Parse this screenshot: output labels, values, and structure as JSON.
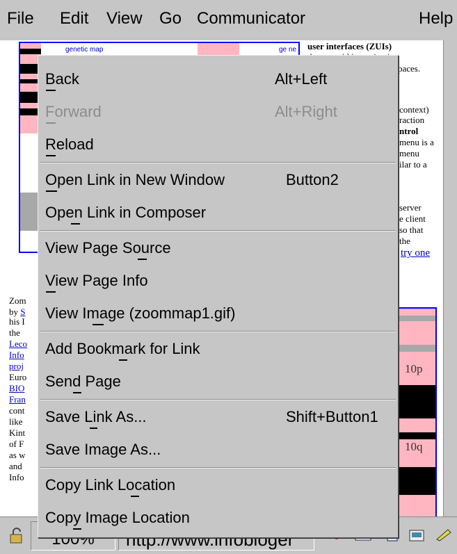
{
  "menubar": {
    "items": [
      "File",
      "Edit",
      "View",
      "Go",
      "Communicator"
    ],
    "help": "Help"
  },
  "page": {
    "map_label_1": "genetic map",
    "map_label_2": "ge ne",
    "map_band_1": "10p",
    "map_band_2": "10q",
    "right_text": [
      "user interfaces (ZUIs)",
      "that can aid in navigating",
      "paces.",
      "context)",
      "raction",
      "ntrol",
      "menu is a",
      "menu",
      "ilar to a",
      "server",
      "e client",
      "so that",
      "the"
    ],
    "right_link": "try one",
    "left_text": [
      "Zom",
      "by ",
      "his I",
      "the ",
      "Leco",
      "Info",
      "proj",
      "Euro",
      "BIO",
      "Fran",
      "cont",
      "like ",
      "Kint",
      "of F",
      "as w",
      "and ",
      "Info"
    ],
    "left_link_s": "S"
  },
  "statusbar": {
    "zoom": "100%",
    "url": "http://www.infobloger"
  },
  "menu": {
    "items": [
      {
        "label": "Back",
        "accel": "Alt+Left",
        "enabled": true
      },
      {
        "label": "Forward",
        "accel": "Alt+Right",
        "enabled": false
      },
      {
        "label": "Reload",
        "accel": "",
        "enabled": true
      },
      {
        "label": "Open Link in New Window",
        "accel": "Button2",
        "enabled": true
      },
      {
        "label": "Open Link in Composer",
        "accel": "",
        "enabled": true
      },
      {
        "label": "View Page Source",
        "accel": "",
        "enabled": true
      },
      {
        "label": "View Page Info",
        "accel": "",
        "enabled": true
      },
      {
        "label": "View Image (zoommap1.gif)",
        "accel": "",
        "enabled": true
      },
      {
        "label": "Add Bookmark for Link",
        "accel": "",
        "enabled": true
      },
      {
        "label": "Send Page",
        "accel": "",
        "enabled": true
      },
      {
        "label": "Save Link As...",
        "accel": "Shift+Button1",
        "enabled": true
      },
      {
        "label": "Save Image As...",
        "accel": "",
        "enabled": true
      },
      {
        "label": "Copy Link Location",
        "accel": "",
        "enabled": true
      },
      {
        "label": "Copy Image Location",
        "accel": "",
        "enabled": true
      }
    ]
  },
  "icons": [
    "lock-icon",
    "navigator-icon",
    "mail-icon",
    "discussion-icon",
    "composer-icon",
    "edit-icon"
  ]
}
